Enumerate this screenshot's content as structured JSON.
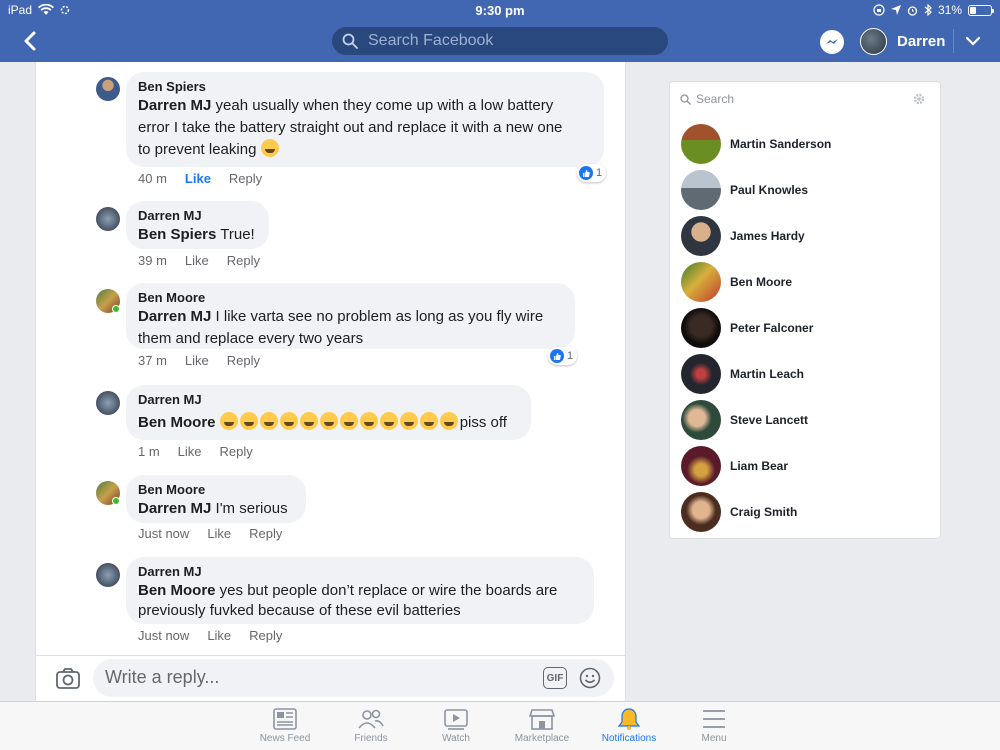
{
  "status": {
    "device": "iPad",
    "time": "9:30 pm",
    "battery": "31%"
  },
  "nav": {
    "search_placeholder": "Search Facebook",
    "user_name": "Darren"
  },
  "comments": [
    {
      "author": "Ben Spiers",
      "mention": "Darren MJ",
      "text_lines": [
        " yeah usually when they come up with a low battery",
        "error I take the battery straight out and replace it with a new one",
        "to prevent leaking "
      ],
      "time": "40 m",
      "like": "Like",
      "reply": "Reply",
      "reaction_count": "1"
    },
    {
      "author": "Darren MJ",
      "mention": "Ben Spiers",
      "text": " True!",
      "time": "39 m",
      "like": "Like",
      "reply": "Reply"
    },
    {
      "author": "Ben Moore",
      "mention": "Darren MJ",
      "text_lines": [
        " I like varta see no problem as long as you fly wire",
        "them and replace every two years"
      ],
      "time": "37 m",
      "like": "Like",
      "reply": "Reply",
      "reaction_count": "1"
    },
    {
      "author": "Darren MJ",
      "mention": "Ben Moore",
      "text_after_emoji": "piss off",
      "emoji_count": 12,
      "time": "1 m",
      "like": "Like",
      "reply": "Reply"
    },
    {
      "author": "Ben Moore",
      "mention": "Darren MJ",
      "text": " I'm serious",
      "time": "Just now",
      "like": "Like",
      "reply": "Reply"
    },
    {
      "author": "Darren MJ",
      "mention": "Ben Moore",
      "text_lines": [
        " yes but people don’t replace or wire the boards are",
        "previously fuvked because of these evil batteries"
      ],
      "time": "Just now",
      "like": "Like",
      "reply": "Reply"
    }
  ],
  "composer": {
    "placeholder": "Write a reply...",
    "gif_label": "GIF"
  },
  "tabs": [
    {
      "label": "News Feed"
    },
    {
      "label": "Friends"
    },
    {
      "label": "Watch"
    },
    {
      "label": "Marketplace"
    },
    {
      "label": "Notifications"
    },
    {
      "label": "Menu"
    }
  ],
  "contacts": {
    "search_placeholder": "Search",
    "people": [
      {
        "name": "Martin Sanderson"
      },
      {
        "name": "Paul Knowles"
      },
      {
        "name": "James Hardy"
      },
      {
        "name": "Ben Moore"
      },
      {
        "name": "Peter Falconer"
      },
      {
        "name": "Martin Leach"
      },
      {
        "name": "Steve Lancett"
      },
      {
        "name": "Liam Bear"
      },
      {
        "name": "Craig Smith"
      }
    ]
  },
  "colors": {
    "brand": "#4267b2",
    "like_blue": "#1877f2",
    "online": "#42b72a"
  }
}
